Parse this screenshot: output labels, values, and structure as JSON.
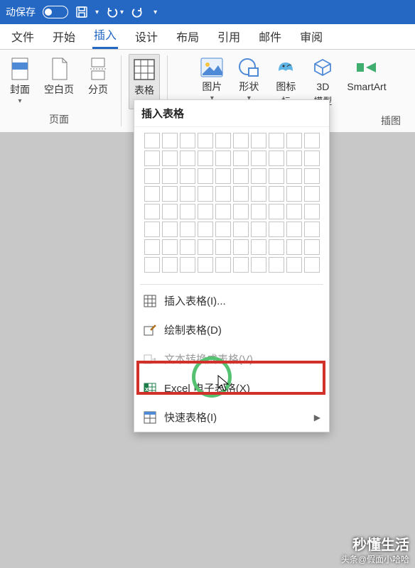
{
  "titlebar": {
    "autosave_label": "动保存",
    "toggle_state": "off"
  },
  "tabs": {
    "items": [
      "文件",
      "开始",
      "插入",
      "设计",
      "布局",
      "引用",
      "邮件",
      "审阅"
    ],
    "active_index": 2
  },
  "ribbon": {
    "group_pages": {
      "label": "页面",
      "items": [
        {
          "label": "封面",
          "icon": "cover-page-icon",
          "hasDropdown": true
        },
        {
          "label": "空白页",
          "icon": "blank-page-icon",
          "hasDropdown": false
        },
        {
          "label": "分页",
          "icon": "page-break-icon",
          "hasDropdown": false
        }
      ]
    },
    "group_tables": {
      "items": [
        {
          "label": "表格",
          "icon": "table-icon",
          "hasDropdown": true,
          "active": true
        }
      ]
    },
    "group_illustrations": {
      "label": "插图",
      "items": [
        {
          "label": "图片",
          "icon": "picture-icon",
          "hasDropdown": true
        },
        {
          "label": "形状",
          "icon": "shapes-icon",
          "hasDropdown": true
        },
        {
          "label": "图标",
          "sublabel": "标",
          "icon": "icons-icon",
          "hasDropdown": false
        },
        {
          "label": "3D",
          "sublabel": "模型",
          "icon": "3d-model-icon",
          "hasDropdown": true
        },
        {
          "label": "SmartArt",
          "icon": "smartart-icon",
          "hasDropdown": false
        }
      ]
    }
  },
  "dropdown": {
    "title": "插入表格",
    "grid": {
      "cols": 10,
      "rows": 8
    },
    "items": [
      {
        "label": "插入表格(I)...",
        "icon": "table-icon",
        "interact": true
      },
      {
        "label": "绘制表格(D)",
        "icon": "draw-table-icon",
        "interact": true,
        "highlighted": true
      },
      {
        "label": "文本转换成表格(V)...",
        "icon": "convert-text-icon",
        "interact": false
      },
      {
        "label": "Excel 电子表格(X)",
        "icon": "excel-icon",
        "interact": true
      },
      {
        "label": "快速表格(I)",
        "icon": "quick-tables-icon",
        "interact": true,
        "hasSubmenu": true
      }
    ]
  },
  "watermark": {
    "main": "秒懂生活",
    "sub": "头条@假面小哈哈"
  }
}
